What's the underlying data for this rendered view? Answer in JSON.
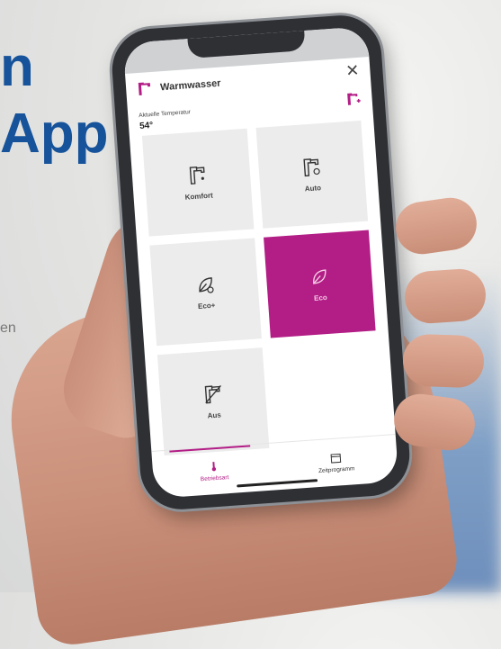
{
  "headline": {
    "line1": "n",
    "line2": "App"
  },
  "side_text": "en",
  "status": {
    "time": ""
  },
  "header": {
    "title": "Warmwasser",
    "temp_label": "Aktuelle Temperatur",
    "temp_value": "54°"
  },
  "tiles": [
    {
      "label": "Komfort",
      "icon": "faucet-icon"
    },
    {
      "label": "Auto",
      "icon": "faucet-auto-icon"
    },
    {
      "label": "Eco+",
      "icon": "leaf-plus-icon"
    },
    {
      "label": "Eco",
      "icon": "leaf-icon",
      "active": true
    },
    {
      "label": "Aus",
      "icon": "faucet-off-icon"
    }
  ],
  "nav": {
    "item1": "Betriebsart",
    "item2": "Zeitprogramm"
  },
  "colors": {
    "accent": "#b31d86",
    "headline": "#16539a",
    "tile": "#ececec"
  }
}
